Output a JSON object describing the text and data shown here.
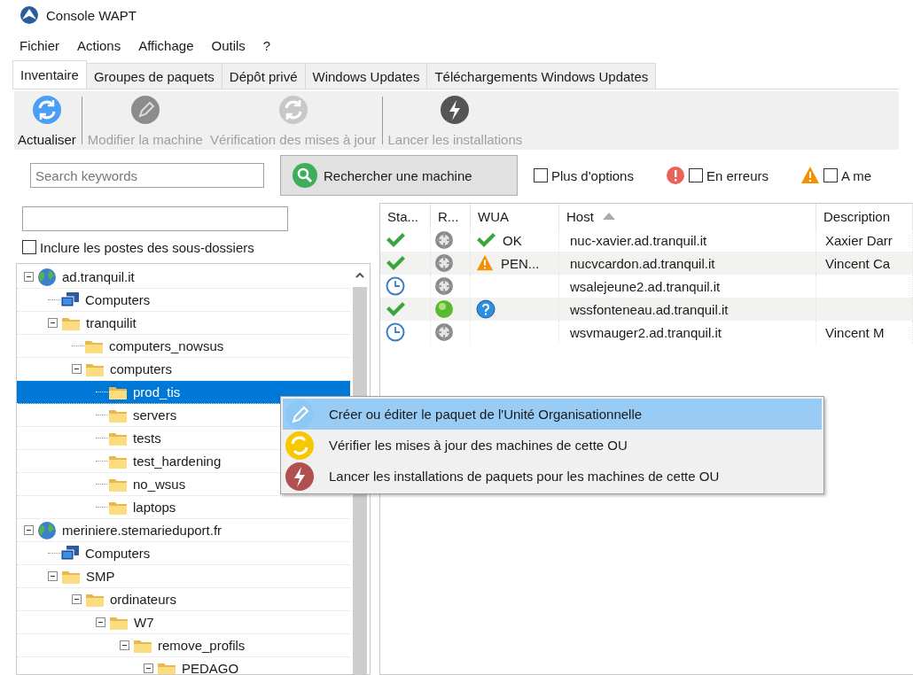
{
  "window": {
    "title": "Console WAPT"
  },
  "menu": [
    "Fichier",
    "Actions",
    "Affichage",
    "Outils",
    "?"
  ],
  "tabs": [
    {
      "label": "Inventaire",
      "selected": true
    },
    {
      "label": "Groupes de paquets",
      "selected": false
    },
    {
      "label": "Dépôt privé",
      "selected": false
    },
    {
      "label": "Windows Updates",
      "selected": false
    },
    {
      "label": "Téléchargements Windows Updates",
      "selected": false
    }
  ],
  "toolbar": [
    {
      "label": "Actualiser",
      "kind": "refresh",
      "disabled": false
    },
    {
      "label": "Modifier la machine",
      "kind": "edit",
      "disabled": true
    },
    {
      "label": "Vérification des mises à jour",
      "kind": "refresh",
      "disabled": true
    },
    {
      "label": "Lancer les installations",
      "kind": "launch",
      "disabled": true
    }
  ],
  "search": {
    "placeholder": "Search keywords",
    "button": "Rechercher une machine"
  },
  "filters": [
    {
      "label": "Plus d'options",
      "kind": "plain",
      "checked": false
    },
    {
      "label": "En erreurs",
      "kind": "error",
      "checked": false
    },
    {
      "label": "A me",
      "kind": "warning",
      "checked": false
    }
  ],
  "ou_panel": {
    "include_subfolders": {
      "label": "Inclure les postes des sous-dossiers",
      "checked": false
    }
  },
  "tree": [
    {
      "label": "ad.tranquil.it",
      "kind": "domain",
      "expanded": true,
      "selected": false,
      "children": [
        {
          "label": "Computers",
          "kind": "computers",
          "selected": false
        },
        {
          "label": "tranquilit",
          "kind": "folder",
          "expanded": true,
          "selected": false,
          "children": [
            {
              "label": "computers_nowsus",
              "kind": "folder",
              "selected": false
            },
            {
              "label": "computers",
              "kind": "folder",
              "expanded": true,
              "selected": false,
              "children": [
                {
                  "label": "prod_tis",
                  "kind": "folder",
                  "selected": true
                },
                {
                  "label": "servers",
                  "kind": "folder",
                  "selected": false
                },
                {
                  "label": "tests",
                  "kind": "folder",
                  "selected": false
                },
                {
                  "label": "test_hardening",
                  "kind": "folder",
                  "selected": false
                },
                {
                  "label": "no_wsus",
                  "kind": "folder",
                  "selected": false
                },
                {
                  "label": "laptops",
                  "kind": "folder",
                  "selected": false
                }
              ]
            }
          ]
        }
      ]
    },
    {
      "label": "meriniere.stemarieduport.fr",
      "kind": "domain",
      "expanded": true,
      "selected": false,
      "children": [
        {
          "label": "Computers",
          "kind": "computers",
          "selected": false
        },
        {
          "label": "SMP",
          "kind": "folder",
          "expanded": true,
          "selected": false,
          "children": [
            {
              "label": "ordinateurs",
              "kind": "folder",
              "expanded": true,
              "selected": false,
              "children": [
                {
                  "label": "W7",
                  "kind": "folder",
                  "expanded": true,
                  "selected": false,
                  "children": [
                    {
                      "label": "remove_profils",
                      "kind": "folder",
                      "expanded": true,
                      "selected": false,
                      "children": [
                        {
                          "label": "PEDAGO",
                          "kind": "folder",
                          "expanded": true,
                          "selected": false
                        }
                      ]
                    }
                  ]
                }
              ]
            }
          ]
        }
      ]
    }
  ],
  "table": {
    "columns": [
      "Sta...",
      "R...",
      "WUA",
      "Host",
      "Description"
    ],
    "rows": [
      {
        "status": {
          "kind": "ok"
        },
        "reachable": {
          "kind": "unknown"
        },
        "wua": {
          "kind": "ok",
          "text": "OK"
        },
        "host": "nuc-xavier.ad.tranquil.it",
        "description": "Xaxier Darr"
      },
      {
        "status": {
          "kind": "ok"
        },
        "reachable": {
          "kind": "unknown"
        },
        "wua": {
          "kind": "warning",
          "text": "PEN..."
        },
        "host": "nucvcardon.ad.tranquil.it",
        "description": "Vincent Ca"
      },
      {
        "status": {
          "kind": "pending"
        },
        "reachable": {
          "kind": "unknown"
        },
        "host": "wsalejeune2.ad.tranquil.it"
      },
      {
        "status": {
          "kind": "ok"
        },
        "reachable": {
          "kind": "online"
        },
        "wua": {
          "kind": "unknown"
        },
        "host": "wssfonteneau.ad.tranquil.it"
      },
      {
        "status": {
          "kind": "pending"
        },
        "reachable": {
          "kind": "unknown"
        },
        "host": "wsvmauger2.ad.tranquil.it",
        "description": "Vincent M"
      }
    ]
  },
  "context_menu": [
    {
      "label": "Créer ou éditer le paquet de l'Unité Organisationnelle",
      "kind": "edit",
      "selected": true
    },
    {
      "label": "Vérifier les mises à jour des machines de cette OU",
      "kind": "refresh",
      "selected": false
    },
    {
      "label": "Lancer les installations de paquets pour les machines de cette OU",
      "kind": "launch",
      "selected": false
    }
  ]
}
